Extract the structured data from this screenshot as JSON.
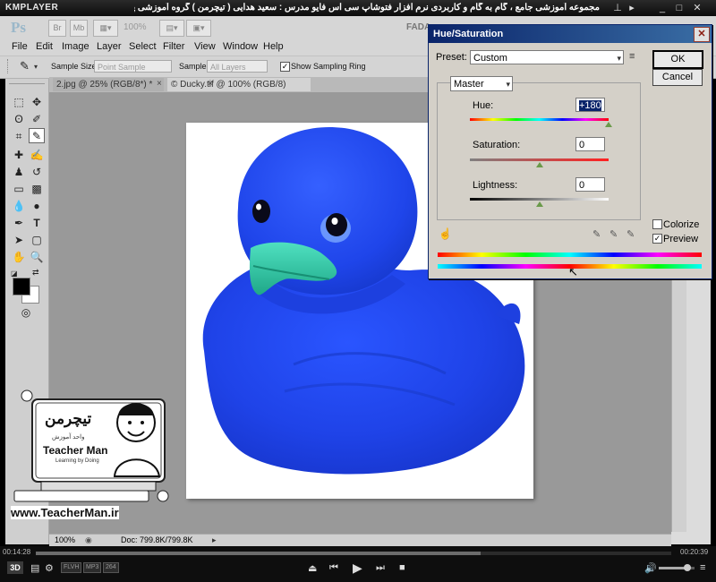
{
  "player": {
    "app_name": "KMPLAYER",
    "title": "مجموعه آموزشی جامع ، گام به گام و کاربردی نرم افزار فتوشاپ سی اس فایو  مدرس : سعید هدایی ( تیچرمن ) گروه آموزشی پادشاه گرافیست ها",
    "time_elapsed": "00:14:28",
    "time_total": "00:20:39",
    "progress": 0.7,
    "badge_labels": [
      "FLVH",
      "MP3",
      "264"
    ],
    "mode_3d": "3D"
  },
  "photoshop": {
    "logo": "Ps",
    "app_bar": {
      "mb_label": "Mb",
      "zoom": "100%",
      "workspace": "FADA"
    },
    "menu": [
      "File",
      "Edit",
      "Image",
      "Layer",
      "Select",
      "Filter",
      "View",
      "Window",
      "Help"
    ],
    "options": {
      "sample_size_label": "Sample Size:",
      "sample_size_value": "Point Sample",
      "sample_label": "Sample:",
      "sample_value": "All Layers",
      "show_ring_label": "Show Sampling Ring",
      "show_ring_checked": true
    },
    "tabs": [
      {
        "label": "2.jpg @ 25% (RGB/8*) *",
        "close": "×"
      },
      {
        "label": "© Ducky.tif @ 100% (RGB/8)",
        "close": "×"
      }
    ],
    "status": {
      "zoom": "100%",
      "doc": "Doc: 799.8K/799.8K"
    }
  },
  "dialog": {
    "title": "Hue/Saturation",
    "preset_label": "Preset:",
    "preset_value": "Custom",
    "ok": "OK",
    "cancel": "Cancel",
    "channel": "Master",
    "hue_label": "Hue:",
    "hue_value": "+180",
    "hue_level": 1.0,
    "saturation_label": "Saturation:",
    "saturation_value": "0",
    "saturation_level": 0.5,
    "lightness_label": "Lightness:",
    "lightness_value": "0",
    "lightness_level": 0.5,
    "colorize_label": "Colorize",
    "colorize_checked": false,
    "preview_label": "Preview",
    "preview_checked": true
  },
  "watermark": {
    "logo_text": "تیچرمن",
    "subtitle": "واحد آموزش",
    "name": "Teacher Man",
    "tagline": "Learning by Doing",
    "url": "www.TeacherMan.ir"
  },
  "colors": {
    "duck_blue": "#1f43e8",
    "beak_teal": "#2fbe9f",
    "dialog_title": "#0a246a",
    "canvas_gray": "#999999"
  }
}
